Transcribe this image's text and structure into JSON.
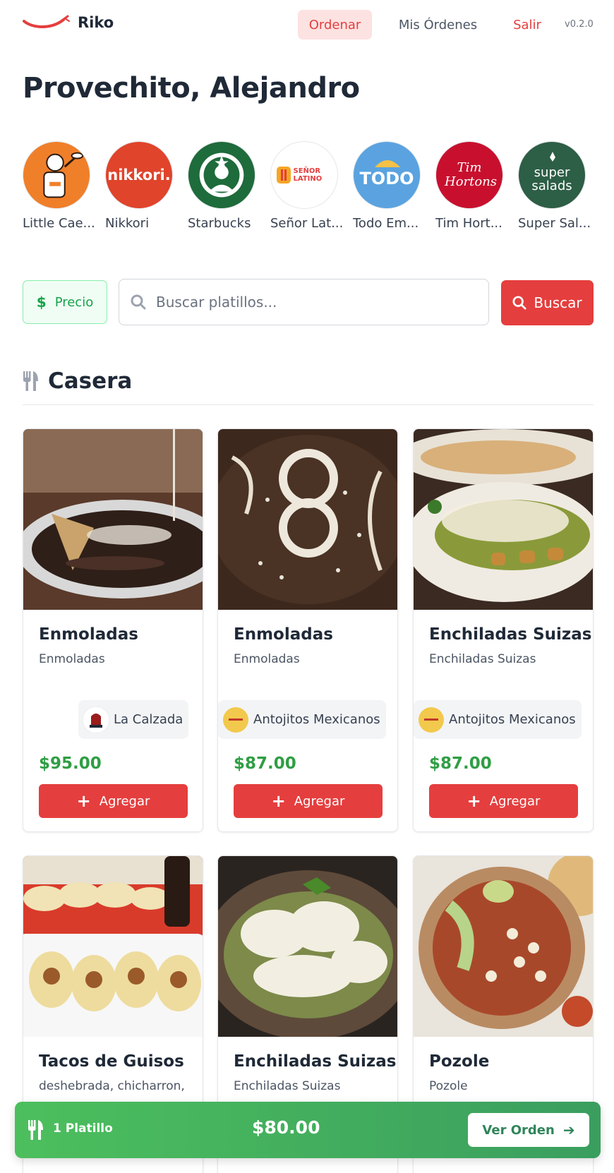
{
  "header": {
    "brand": "Riko",
    "nav_order": "Ordenar",
    "nav_my_orders": "Mis Órdenes",
    "nav_logout": "Salir",
    "version": "v0.2.0",
    "accent_color": "#e53e3e"
  },
  "greeting": "Provechito, Alejandro",
  "restaurants": [
    {
      "name": "Little Cae...",
      "logo": "little-caesars-logo"
    },
    {
      "name": "Nikkori",
      "logo": "nikkori-logo",
      "logo_text": "nikkori."
    },
    {
      "name": "Starbucks",
      "logo": "starbucks-logo"
    },
    {
      "name": "Señor Lat...",
      "logo": "senor-latino-logo",
      "logo_text": "SEÑOR LATINO"
    },
    {
      "name": "Todo Em...",
      "logo": "todo-empanadas-logo",
      "logo_text": "TODO"
    },
    {
      "name": "Tim Hort...",
      "logo": "tim-hortons-logo",
      "logo_text": "Tim Hortons"
    },
    {
      "name": "Super Sal...",
      "logo": "super-salads-logo",
      "logo_text": "super salads"
    }
  ],
  "filters": {
    "price_label": "Precio",
    "search_placeholder": "Buscar platillos...",
    "search_button": "Buscar"
  },
  "category": {
    "icon": "utensils-icon",
    "title": "Casera"
  },
  "dishes": [
    {
      "title": "Enmoladas",
      "description": "Enmoladas",
      "restaurant": "La Calzada",
      "price": "$95.00",
      "add_label": "Agregar",
      "image": "enmoladas-photo"
    },
    {
      "title": "Enmoladas",
      "description": "Enmoladas",
      "restaurant": "Antojitos Mexicanos",
      "price": "$87.00",
      "add_label": "Agregar",
      "image": "enmoladas-closeup-photo"
    },
    {
      "title": "Enchiladas Suizas",
      "description": "Enchiladas Suizas",
      "restaurant": "Antojitos Mexicanos",
      "price": "$87.00",
      "add_label": "Agregar",
      "image": "enchiladas-verdes-photo"
    },
    {
      "title": "Tacos de Guisos",
      "description": "deshebrada, chicharron,",
      "image": "tacos-photo"
    },
    {
      "title": "Enchiladas Suizas",
      "description": "Enchiladas Suizas",
      "image": "enchiladas-suizas-photo"
    },
    {
      "title": "Pozole",
      "description": "Pozole",
      "image": "pozole-photo"
    }
  ],
  "order_bar": {
    "count": "1 Platillo",
    "total": "$80.00",
    "view_label": "Ver Orden"
  }
}
